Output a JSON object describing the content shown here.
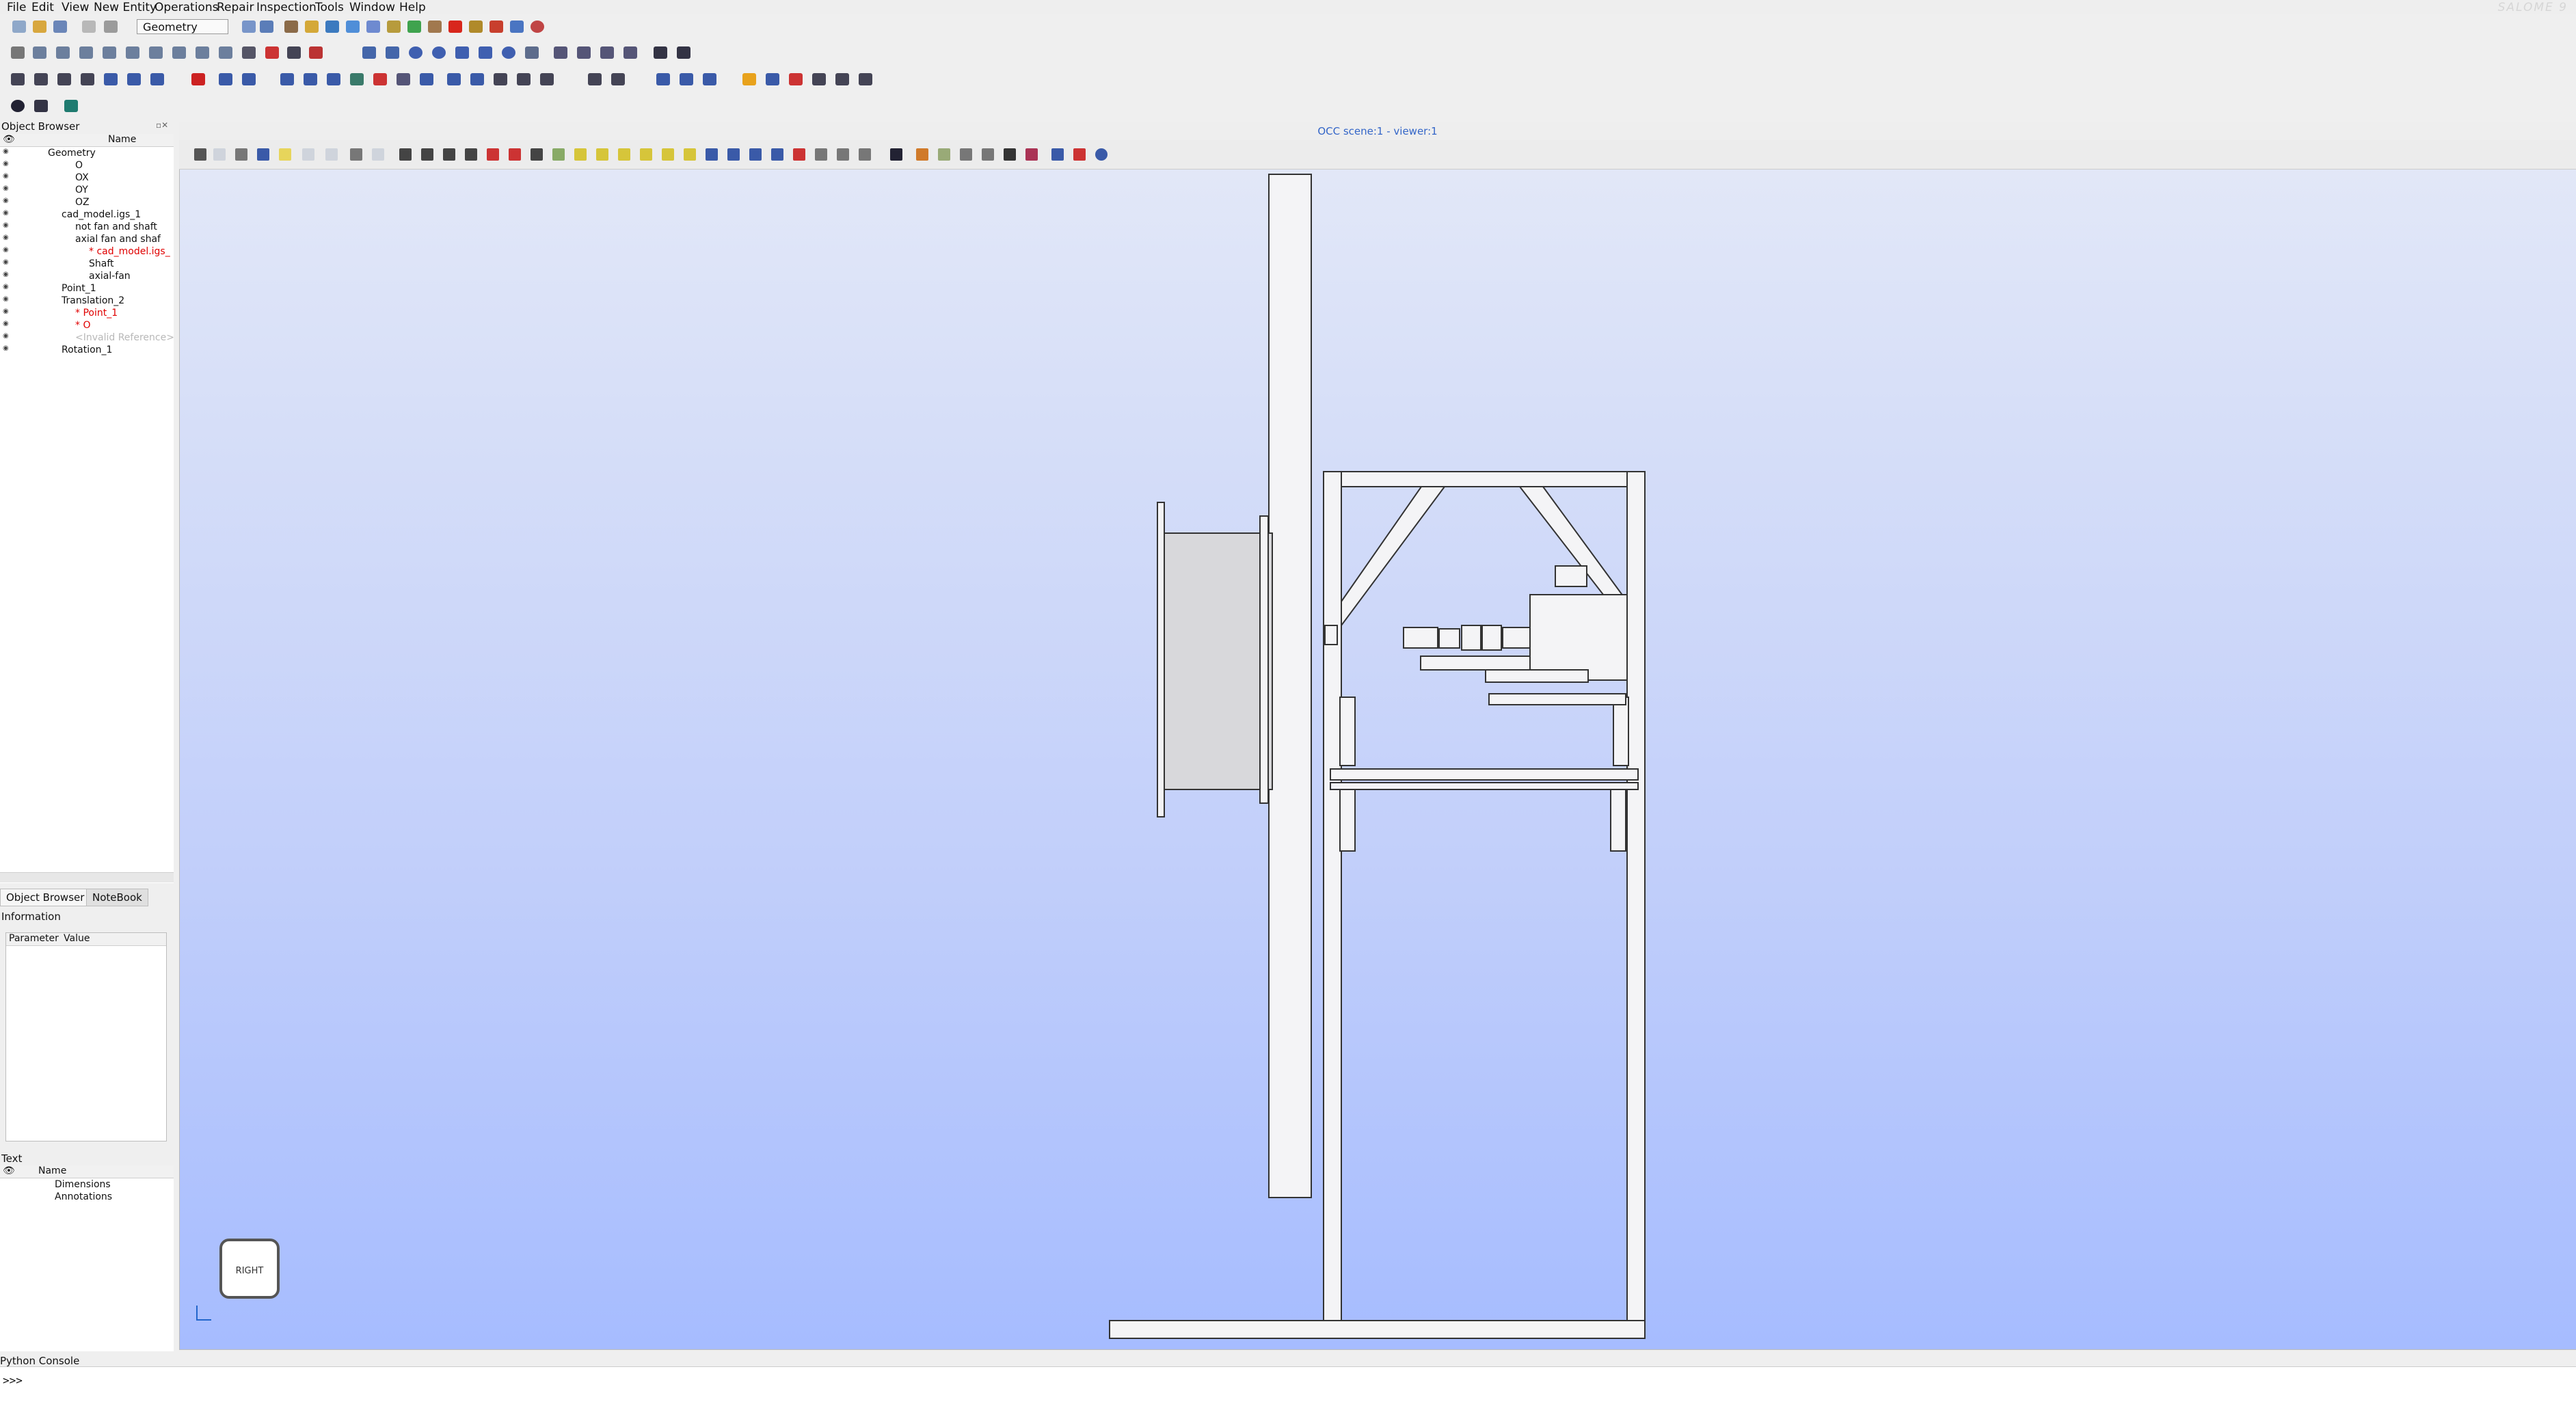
{
  "menu": [
    "File",
    "Edit",
    "View",
    "New Entity",
    "Operations",
    "Repair",
    "Inspection",
    "Tools",
    "Window",
    "Help"
  ],
  "brand": "SALOME 9",
  "module_selector": "Geometry",
  "object_browser": {
    "title": "Object Browser",
    "column_header": "Name",
    "tree": [
      {
        "label": "Geometry",
        "indent": 0,
        "color": "#111"
      },
      {
        "label": "O",
        "indent": 2,
        "color": "#111"
      },
      {
        "label": "OX",
        "indent": 2,
        "color": "#111"
      },
      {
        "label": "OY",
        "indent": 2,
        "color": "#111"
      },
      {
        "label": "OZ",
        "indent": 2,
        "color": "#111"
      },
      {
        "label": "cad_model.igs_1",
        "indent": 1,
        "color": "#111"
      },
      {
        "label": "not fan and shaft",
        "indent": 2,
        "color": "#111"
      },
      {
        "label": "axial fan and shaf",
        "indent": 2,
        "color": "#111"
      },
      {
        "label": "* cad_model.igs_",
        "indent": 3,
        "color": "#e00000"
      },
      {
        "label": "Shaft",
        "indent": 3,
        "color": "#111"
      },
      {
        "label": "axial-fan",
        "indent": 3,
        "color": "#111"
      },
      {
        "label": "Point_1",
        "indent": 1,
        "color": "#111"
      },
      {
        "label": "Translation_2",
        "indent": 1,
        "color": "#111"
      },
      {
        "label": "* Point_1",
        "indent": 2,
        "color": "#e00000"
      },
      {
        "label": "* O",
        "indent": 2,
        "color": "#e00000"
      },
      {
        "label": "<Invalid Reference>",
        "indent": 2,
        "color": "#b8b8b8"
      },
      {
        "label": "Rotation_1",
        "indent": 1,
        "color": "#111"
      }
    ],
    "tabs": [
      "Object Browser",
      "NoteBook"
    ]
  },
  "information": {
    "title": "Information",
    "col_param": "Parameter",
    "col_value": "Value"
  },
  "text_panel": {
    "title": "Text",
    "column_header": "Name",
    "items": [
      "Dimensions",
      "Annotations"
    ]
  },
  "viewer": {
    "title": "OCC scene:1 - viewer:1",
    "view_label": "RIGHT"
  },
  "console": {
    "title": "Python Console",
    "prompt": ">>>"
  },
  "colors": {
    "viewer_top": "#e4e9f7",
    "viewer_bottom": "#a6bcff",
    "accent": "#3466c8"
  }
}
